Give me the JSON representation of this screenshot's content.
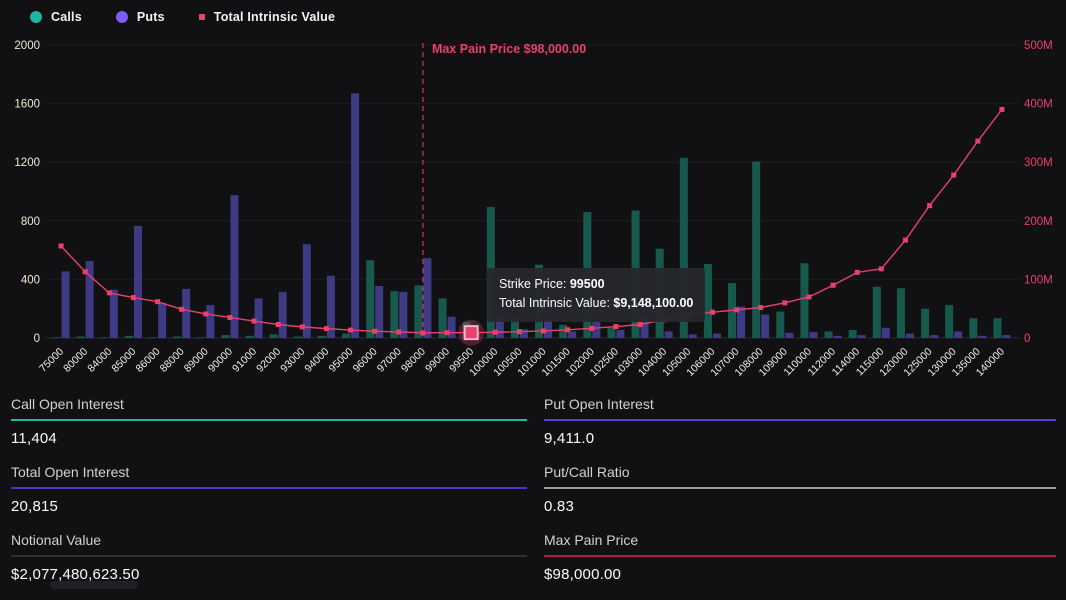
{
  "colors": {
    "background": "#111114",
    "grid": "#1c1d20",
    "axis_line": "#2b2b2f",
    "left_axis_labels": "#efe8d2",
    "x_axis_labels": "#f2f0e6",
    "right_axis_labels": "#e8416b",
    "calls_bar": "#175a4d",
    "puts_bar": "#3e3a84",
    "line": "#e8416b",
    "max_pain_line": "#cf3561",
    "tooltip_bg": "#27282d"
  },
  "legend": {
    "items": [
      {
        "label": "Calls",
        "color": "#23b3a1",
        "shape": "dot"
      },
      {
        "label": "Puts",
        "color": "#7e5bfa",
        "shape": "dot"
      },
      {
        "label": "Total Intrinsic Value",
        "color": "#e8416b",
        "shape": "square"
      }
    ]
  },
  "chart_data": {
    "type": "bar",
    "title": "",
    "xlabel": "",
    "ylabel": "",
    "categories": [
      "75000",
      "80000",
      "84000",
      "85000",
      "86000",
      "88000",
      "89000",
      "90000",
      "91000",
      "92000",
      "93000",
      "94000",
      "95000",
      "96000",
      "97000",
      "98000",
      "99000",
      "99500",
      "100000",
      "100500",
      "101000",
      "101500",
      "102000",
      "102500",
      "103000",
      "104000",
      "105000",
      "106000",
      "107000",
      "108000",
      "109000",
      "110000",
      "112000",
      "114000",
      "115000",
      "120000",
      "125000",
      "130000",
      "135000",
      "140000"
    ],
    "series": [
      {
        "name": "Calls",
        "type": "bar",
        "axis": "left",
        "values": [
          5,
          10,
          5,
          15,
          5,
          10,
          5,
          20,
          15,
          25,
          10,
          15,
          30,
          530,
          320,
          360,
          270,
          110,
          895,
          140,
          500,
          90,
          860,
          70,
          870,
          610,
          1230,
          505,
          375,
          1205,
          180,
          510,
          45,
          55,
          350,
          340,
          200,
          225,
          135,
          135
        ]
      },
      {
        "name": "Puts",
        "type": "bar",
        "axis": "left",
        "values": [
          455,
          525,
          330,
          765,
          240,
          335,
          225,
          975,
          270,
          315,
          640,
          425,
          1670,
          355,
          315,
          545,
          145,
          40,
          150,
          60,
          125,
          45,
          110,
          55,
          150,
          45,
          25,
          30,
          215,
          160,
          35,
          40,
          15,
          20,
          70,
          30,
          20,
          45,
          15,
          20
        ]
      },
      {
        "name": "Total Intrinsic Value",
        "type": "line",
        "axis": "right",
        "values_millions": [
          157,
          113,
          77,
          69,
          62,
          49,
          41,
          35,
          29,
          23,
          19,
          16,
          13.5,
          11.5,
          10.3,
          8.9,
          9,
          9.148,
          9.8,
          10.8,
          12,
          14,
          16.5,
          19.5,
          23,
          31,
          40,
          44,
          48,
          52,
          60,
          70,
          90,
          112,
          118,
          167,
          226,
          278,
          336,
          390
        ]
      }
    ],
    "left_axis": {
      "ticks": [
        0,
        400,
        800,
        1200,
        1600,
        2000
      ],
      "max": 2000
    },
    "right_axis": {
      "ticks": [
        "0",
        "100M",
        "200M",
        "300M",
        "400M",
        "500M"
      ],
      "max_millions": 500
    },
    "max_pain": {
      "strike": "98000",
      "label": "Max Pain Price $98,000.00"
    },
    "highlight": {
      "strike": "99500"
    },
    "grid": true,
    "legend_position": "top-left"
  },
  "tooltip": {
    "line1_label": "Strike Price: ",
    "line1_value": "99500",
    "line2_label": "Total Intrinsic Value: ",
    "line2_value": "$9,148,100.00"
  },
  "stats": [
    {
      "label": "Call Open Interest",
      "value": "11,404",
      "underline": "#2bb2a1"
    },
    {
      "label": "Put Open Interest",
      "value": "9,411.0",
      "underline": "#5a3ddb"
    },
    {
      "label": "Total Open Interest",
      "value": "20,815",
      "underline": "#4637cf"
    },
    {
      "label": "Put/Call Ratio",
      "value": "0.83",
      "underline": "#9b9b9f"
    },
    {
      "label": "Notional Value",
      "value": "$2,077,480,623.50",
      "underline": "#2f2f33"
    },
    {
      "label": "Max Pain Price",
      "value": "$98,000.00",
      "underline": "#b71c4e"
    }
  ]
}
